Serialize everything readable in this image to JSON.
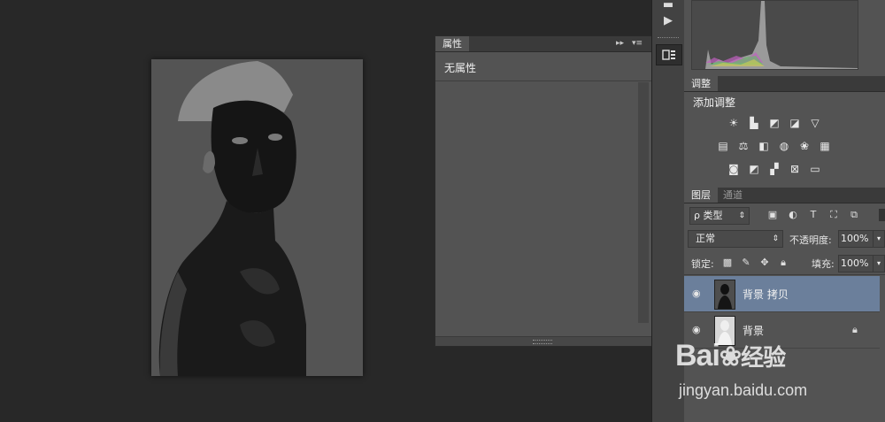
{
  "properties_panel": {
    "tab_label": "属性",
    "menu_icon": "panel-menu-icon",
    "empty_text": "无属性"
  },
  "adjustments_panel": {
    "tab_label": "调整",
    "title": "添加调整",
    "icons_row1": [
      "brightness-icon",
      "levels-icon",
      "curves-icon",
      "exposure-icon",
      "vibrance-icon"
    ],
    "icons_row2": [
      "hue-saturation-icon",
      "color-balance-icon",
      "black-white-icon",
      "photo-filter-icon",
      "channel-mixer-icon",
      "color-lookup-icon"
    ],
    "icons_row3": [
      "invert-icon",
      "posterize-icon",
      "threshold-icon",
      "selective-color-icon",
      "gradient-map-icon"
    ]
  },
  "layers_panel": {
    "tabs": [
      {
        "label": "图层",
        "active": true
      },
      {
        "label": "通道",
        "active": false
      }
    ],
    "filter_label": "ρ 类型",
    "blend_mode": "正常",
    "opacity_label": "不透明度:",
    "opacity_value": "100%",
    "lock_label": "锁定:",
    "fill_label": "填充:",
    "fill_value": "100%",
    "layers": [
      {
        "name": "背景 拷贝",
        "selected": true,
        "visible": true,
        "locked": false
      },
      {
        "name": "背景",
        "selected": false,
        "visible": true,
        "locked": true
      }
    ]
  },
  "watermark": {
    "brand": "Bai",
    "brand_suffix": "经验",
    "url": "jingyan.baidu.com"
  },
  "colors": {
    "selected_layer": "#6a7f9c",
    "panel_bg": "#535353",
    "canvas_bg": "#282828"
  }
}
